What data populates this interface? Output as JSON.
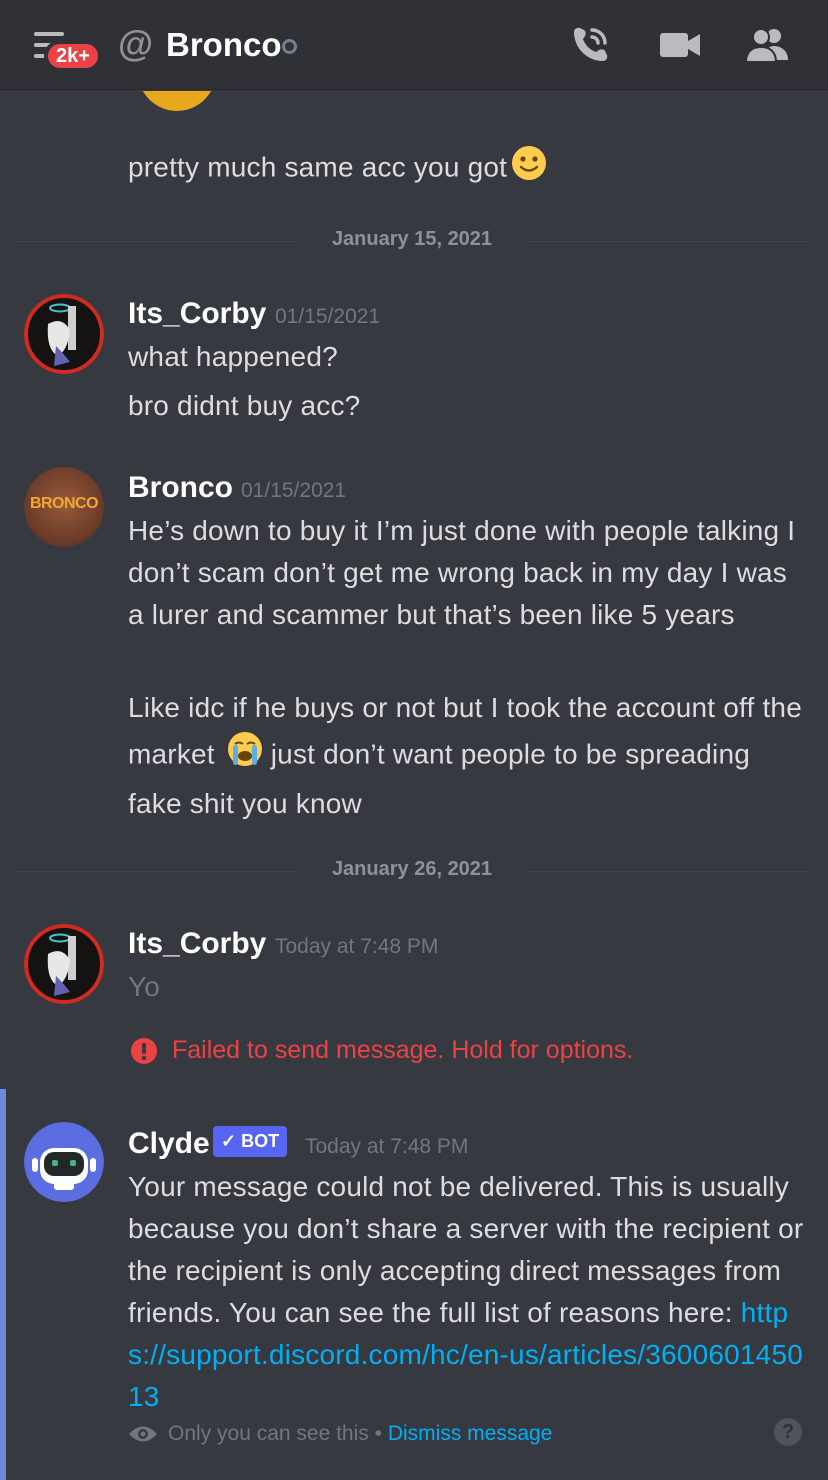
{
  "header": {
    "notification_badge": "2k+",
    "at_symbol": "@",
    "channel_name": "Bronco"
  },
  "messages": {
    "bronco_prev": {
      "text": "pretty much same acc you got"
    },
    "divider_1": "January 15, 2021",
    "corby_1": {
      "author": "Its_Corby",
      "timestamp": "01/15/2021",
      "lines": [
        "what happened?",
        "bro didnt buy acc?"
      ]
    },
    "bronco_1": {
      "author": "Bronco",
      "avatar_text": "BRONCO",
      "timestamp": "01/15/2021",
      "paragraph_1": "He’s down to buy it I’m just done with people talking I don’t scam don’t get me wrong back in my day I was a lurer and scammer but that’s been like 5 years",
      "paragraph_2_before": "Like idc if he buys or not but I took the account off the market",
      "paragraph_2_after": "just don’t want people to be spreading fake shit you know"
    },
    "divider_2": "January 26, 2021",
    "corby_2": {
      "author": "Its_Corby",
      "timestamp": "Today at 7:48 PM",
      "text": "Yo",
      "fail_text": "Failed to send message. Hold for options."
    },
    "clyde": {
      "author": "Clyde",
      "bot_tag": "✓ BOT",
      "timestamp": "Today at 7:48 PM",
      "text": "Your message could not be delivered. This is usually because you don’t share a server with the recipient or the recipient is only accepting direct messages from friends. You can see the full list of reasons here:",
      "link": "https://support.discord.com/hc/en-us/articles/360060145013",
      "ephemeral_note": "Only you can see this",
      "separator": "•",
      "dismiss": "Dismiss message",
      "help": "?"
    }
  },
  "colors": {
    "background": "#36393f",
    "topbar": "#2f3136",
    "danger": "#ed4245",
    "link": "#00aff4",
    "blurple": "#5865f2",
    "ephemeral_bar": "#7289da"
  },
  "icons": [
    "hamburger-icon",
    "at-icon",
    "status-offline-icon",
    "phone-call-icon",
    "video-camera-icon",
    "members-icon",
    "slightly-smiling-emoji",
    "loudly-crying-emoji",
    "alert-circle-icon",
    "eye-icon",
    "help-icon"
  ]
}
